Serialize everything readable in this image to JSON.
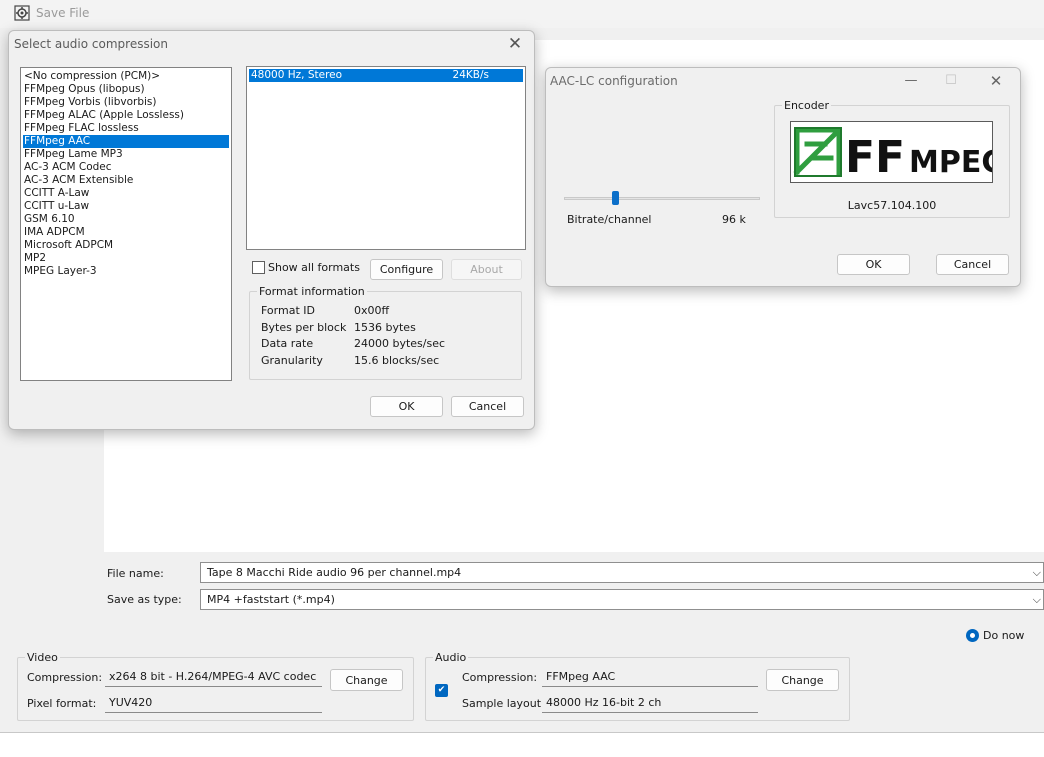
{
  "save_window": {
    "title": "Save File",
    "file_name_label": "File name:",
    "file_name_value": "Tape 8 Macchi Ride audio 96 per channel.mp4",
    "save_type_label": "Save as type:",
    "save_type_value": "MP4 +faststart (*.mp4)",
    "do_now_label": "Do now",
    "video": {
      "group_label": "Video",
      "compression_label": "Compression:",
      "compression_value": "x264 8 bit - H.264/MPEG-4 AVC codec",
      "change_label": "Change",
      "pixel_format_label": "Pixel format:",
      "pixel_format_value": "YUV420"
    },
    "audio": {
      "group_label": "Audio",
      "compression_label": "Compression:",
      "compression_value": "FFMpeg AAC",
      "change_label": "Change",
      "sample_layout_label": "Sample layout:",
      "sample_layout_value": "48000 Hz 16-bit 2 ch"
    }
  },
  "audio_compression_dialog": {
    "title": "Select audio compression",
    "codecs": [
      "<No compression (PCM)>",
      "FFMpeg Opus (libopus)",
      "FFMpeg Vorbis (libvorbis)",
      "FFMpeg ALAC (Apple Lossless)",
      "FFMpeg FLAC lossless",
      "FFMpeg AAC",
      "FFMpeg Lame MP3",
      "AC-3 ACM Codec",
      "AC-3 ACM Extensible",
      "CCITT A-Law",
      "CCITT u-Law",
      "GSM 6.10",
      "IMA ADPCM",
      "Microsoft ADPCM",
      "MP2",
      "MPEG Layer-3"
    ],
    "selected_codec_index": 5,
    "formats": [
      {
        "name": "48000 Hz, Stereo",
        "rate": "24KB/s"
      }
    ],
    "show_all_label": "Show all formats",
    "configure_label": "Configure",
    "about_label": "About",
    "format_info": {
      "title": "Format information",
      "rows": [
        {
          "key": "Format ID",
          "value": "0x00ff"
        },
        {
          "key": "Bytes per block",
          "value": "1536 bytes"
        },
        {
          "key": "Data rate",
          "value": "24000 bytes/sec"
        },
        {
          "key": "Granularity",
          "value": "15.6 blocks/sec"
        }
      ]
    },
    "ok_label": "OK",
    "cancel_label": "Cancel"
  },
  "aac_dialog": {
    "title": "AAC-LC configuration",
    "bitrate_label": "Bitrate/channel",
    "bitrate_value": "96 k",
    "slider_fraction": 0.26,
    "encoder_group_label": "Encoder",
    "logo_text_big": "FF",
    "logo_text_small": "MPEG",
    "encoder_version": "Lavc57.104.100",
    "ok_label": "OK",
    "cancel_label": "Cancel"
  },
  "colors": {
    "selection": "#0078d7",
    "accent": "#0067c0",
    "ffmpeg_green": "#2f9e3f"
  }
}
